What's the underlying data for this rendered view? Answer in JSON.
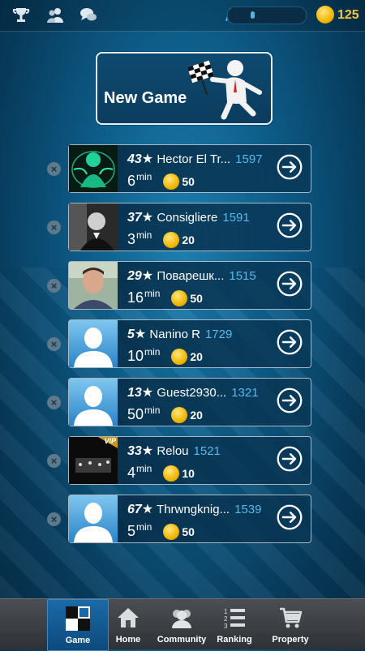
{
  "topbar": {
    "icons": [
      "trophy-icon",
      "friends-icon",
      "chat-icon"
    ],
    "stars_progress": 0.08,
    "coins": "125"
  },
  "new_game": {
    "label": "New Game"
  },
  "games": [
    {
      "stars": "43",
      "name": "Hector El Tr...",
      "rating": "1597",
      "time": "6",
      "unit": "min",
      "bet": "50",
      "avatar": "green-figure"
    },
    {
      "stars": "37",
      "name": "Consigliere",
      "rating": "1591",
      "time": "3",
      "unit": "min",
      "bet": "20",
      "avatar": "photo-bw"
    },
    {
      "stars": "29",
      "name": "Поварешк...",
      "rating": "1515",
      "time": "16",
      "unit": "min",
      "bet": "50",
      "avatar": "photo-man"
    },
    {
      "stars": "5",
      "name": "Nanino R",
      "rating": "1729",
      "time": "10",
      "unit": "min",
      "bet": "20",
      "avatar": "default"
    },
    {
      "stars": "13",
      "name": "Guest2930...",
      "rating": "1321",
      "time": "50",
      "unit": "min",
      "bet": "20",
      "avatar": "default"
    },
    {
      "stars": "33",
      "name": "Relou",
      "rating": "1521",
      "time": "4",
      "unit": "min",
      "bet": "10",
      "avatar": "vip-dark"
    },
    {
      "stars": "67",
      "name": "Thrwngknig...",
      "rating": "1539",
      "time": "5",
      "unit": "min",
      "bet": "50",
      "avatar": "default"
    }
  ],
  "vip_badge": "VIP",
  "nav": [
    {
      "label": "Game",
      "icon": "game-icon",
      "active": true
    },
    {
      "label": "Home",
      "icon": "home-icon",
      "active": false
    },
    {
      "label": "Community",
      "icon": "community-icon",
      "active": false
    },
    {
      "label": "Ranking",
      "icon": "ranking-icon",
      "active": false
    },
    {
      "label": "Property",
      "icon": "cart-icon",
      "active": false
    }
  ],
  "colors": {
    "rating": "#55b9ee",
    "coin": "#f0b600",
    "accent": "#1b6aa7"
  }
}
